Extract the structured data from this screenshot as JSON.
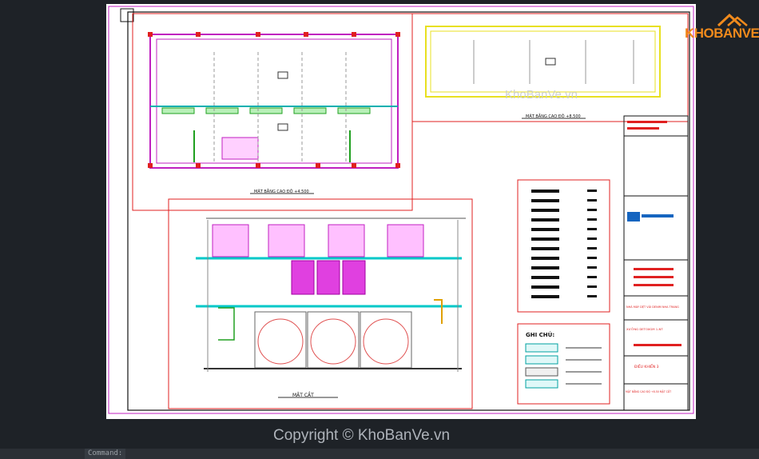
{
  "window": {
    "command_prompt": "Command:"
  },
  "watermarks": {
    "center": "KhoBanVe.vn",
    "bottom": "Copyright © KhoBanVe.vn",
    "logo": "KHOBANVE"
  },
  "drawing": {
    "plan_top_title": "MẶT BẰNG CAO ĐỘ +4.500",
    "plan_roof_title": "MẶT BẰNG CAO ĐỘ +8.500",
    "section_title": "MẶT CẮT",
    "notes_title": "GHI CHÚ:"
  },
  "title_block": {
    "project": "NHÀ MÁY DỆT VẢI DENIM NHA TRANG",
    "item": "XƯỞNG DETOXGM 1-NT",
    "sheet_name": "ĐIỀU KHIỂN 3",
    "sheet_desc": "MẶT BẰNG CAO ĐỘ +8.50 MẶT CẮT"
  },
  "colors": {
    "wall_red": "#e02020",
    "magenta": "#c020c0",
    "cyan": "#00c8c8",
    "yellow": "#e8e020",
    "green": "#20a020",
    "pink_fill": "#ff80ff"
  }
}
